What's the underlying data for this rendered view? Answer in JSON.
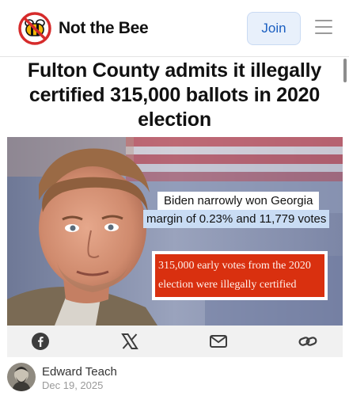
{
  "header": {
    "brand": "Not the Bee",
    "join_label": "Join",
    "logo_icon": "crossed-out-bee-icon",
    "menu_icon": "hamburger-menu-icon"
  },
  "article": {
    "headline": "Fulton County admits it illegally certified 315,000 ballots in 2020 election",
    "image": {
      "caption_line1": "Biden narrowly won Georgia",
      "caption_line2": "margin of 0.23% and 11,779 votes",
      "caption_red_line1": "315,000 early votes from the 2020",
      "caption_red_line2": "election were illegally certified"
    },
    "share_icons": [
      "facebook-icon",
      "x-icon",
      "mail-icon",
      "link-icon"
    ],
    "author": {
      "name": "Edward Teach",
      "date": "Dec 19, 2025"
    }
  },
  "colors": {
    "join_bg": "#e8f0fb",
    "join_text": "#1b5fc1",
    "bee_yellow": "#f2b705",
    "logo_red": "#d62b2b",
    "caption_red": "#d9300f",
    "caption_blue": "#c9dcf4"
  }
}
